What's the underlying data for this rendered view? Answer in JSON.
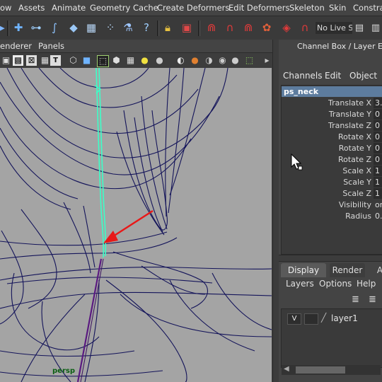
{
  "menubar": {
    "items": [
      "ow",
      "Assets",
      "Animate",
      "Geometry Cache",
      "Create Deformers",
      "Edit Deformers",
      "Skeleton",
      "Skin",
      "Constrai"
    ]
  },
  "shelf": {
    "live_field": "No Live S"
  },
  "panel_menu": {
    "items": [
      "enderer",
      "Panels"
    ]
  },
  "viewport": {
    "camera_label": "persp",
    "wire_color": "#14145a",
    "highlight_color": "#3dffc8",
    "arrow_color": "#e81818"
  },
  "channel_box": {
    "title": "Channel Box / Layer Editor",
    "menus": [
      "Channels",
      "Edit",
      "Object"
    ],
    "node_name": "ps_neck",
    "attributes": [
      {
        "name": "Translate X",
        "value": "3."
      },
      {
        "name": "Translate Y",
        "value": "0"
      },
      {
        "name": "Translate Z",
        "value": "0"
      },
      {
        "name": "Rotate X",
        "value": "0"
      },
      {
        "name": "Rotate Y",
        "value": "0"
      },
      {
        "name": "Rotate Z",
        "value": "0"
      },
      {
        "name": "Scale X",
        "value": "1"
      },
      {
        "name": "Scale Y",
        "value": "1"
      },
      {
        "name": "Scale Z",
        "value": "1"
      },
      {
        "name": "Visibility",
        "value": "on"
      },
      {
        "name": "Radius",
        "value": "0."
      }
    ]
  },
  "layer_editor": {
    "tabs": [
      "Display",
      "Render",
      "A"
    ],
    "menus": [
      "Layers",
      "Options",
      "Help"
    ],
    "layer": {
      "visibility": "V",
      "name": "layer1"
    }
  }
}
